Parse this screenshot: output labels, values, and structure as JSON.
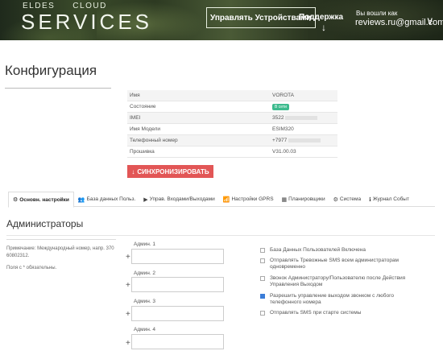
{
  "header": {
    "logo_top_left": "ELDES",
    "logo_top_right": "CLOUD",
    "logo_main": "SERVICES",
    "nav_devices": "Управлять Устройствами",
    "nav_support": "Поддержка",
    "support_arrow": "↓",
    "login_label": "Вы вошли как",
    "login_user": "reviews.ru@gmail.com",
    "login_chevron": "∨"
  },
  "page": {
    "title": "Конфигурация"
  },
  "info": {
    "rows": [
      {
        "key": "Имя",
        "value": "VOROTA"
      },
      {
        "key": "Состояние",
        "value": "В сети"
      },
      {
        "key": "IMEI",
        "value": "3522"
      },
      {
        "key": "Имя Модели",
        "value": "ESIM320"
      },
      {
        "key": "Телефонный номер",
        "value": "+7977"
      },
      {
        "key": "Прошивка",
        "value": "V31.00.03"
      }
    ]
  },
  "sync_button": {
    "label": "СИНХРОНИЗИРОВАТЬ",
    "icon": "↓"
  },
  "tabs": [
    {
      "label": "Основн. настройки",
      "icon": "⚙"
    },
    {
      "label": "База данных Польз.",
      "icon": "👥"
    },
    {
      "label": "Управ. Входами/Выходами",
      "icon": "▶"
    },
    {
      "label": "Настройки GPRS",
      "icon": "📶"
    },
    {
      "label": "Планировщики",
      "icon": "▦"
    },
    {
      "label": "Система",
      "icon": "⚙"
    },
    {
      "label": "Журнал Событ",
      "icon": "ℹ"
    }
  ],
  "section": {
    "title": "Администраторы",
    "note1": "Примечание: Международный номер, напр. 370 60802312.",
    "note2": "Поля с * обязательны."
  },
  "admins": [
    {
      "label": "Админ. 1",
      "value": ""
    },
    {
      "label": "Админ. 2",
      "value": ""
    },
    {
      "label": "Админ. 3",
      "value": ""
    },
    {
      "label": "Админ. 4",
      "value": ""
    }
  ],
  "plus_icon": "+",
  "options": [
    {
      "label": "База Данных Пользователей Включена",
      "checked": false
    },
    {
      "label": "Отправлять Тревожные SMS всем администраторам одновременно",
      "checked": false
    },
    {
      "label": "Звонок Администратору/Пользователю после Действия Управления Выходом",
      "checked": false
    },
    {
      "label": "Разрешить управление выходом звонком с любого телефонного номера",
      "checked": true
    },
    {
      "label": "Отправлять SMS при старте системы",
      "checked": false
    }
  ],
  "colors": {
    "sync_button": "#e25656",
    "online_badge": "#3dbb8e",
    "checkbox_checked": "#3b7dd8"
  }
}
